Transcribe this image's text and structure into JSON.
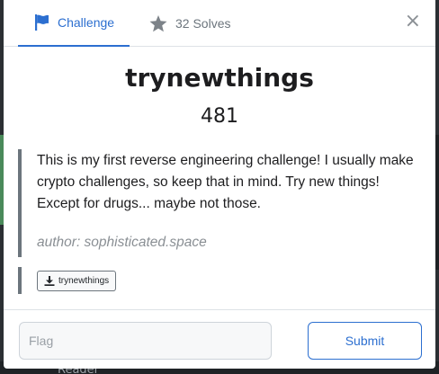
{
  "tabs": {
    "challenge_label": "Challenge",
    "solves_label": "32 Solves"
  },
  "close_glyph": "×",
  "challenge": {
    "name": "trynewthings",
    "points": "481",
    "description": "This is my first reverse engineering challenge! I usually make crypto challenges, so keep that in mind. Try new things! Except for drugs... maybe not those.",
    "author": "author: sophisticated.space"
  },
  "files": [
    {
      "label": "trynewthings"
    }
  ],
  "flag": {
    "placeholder": "Flag",
    "value": ""
  },
  "submit_label": "Submit",
  "background": {
    "bottom_label": "Reader"
  },
  "colors": {
    "accent": "#2c6fd0",
    "muted": "#6c757d"
  },
  "icons": {
    "challenge_tab": "flag-icon",
    "solves_tab": "star-icon",
    "file": "download-icon",
    "close": "close-icon"
  }
}
